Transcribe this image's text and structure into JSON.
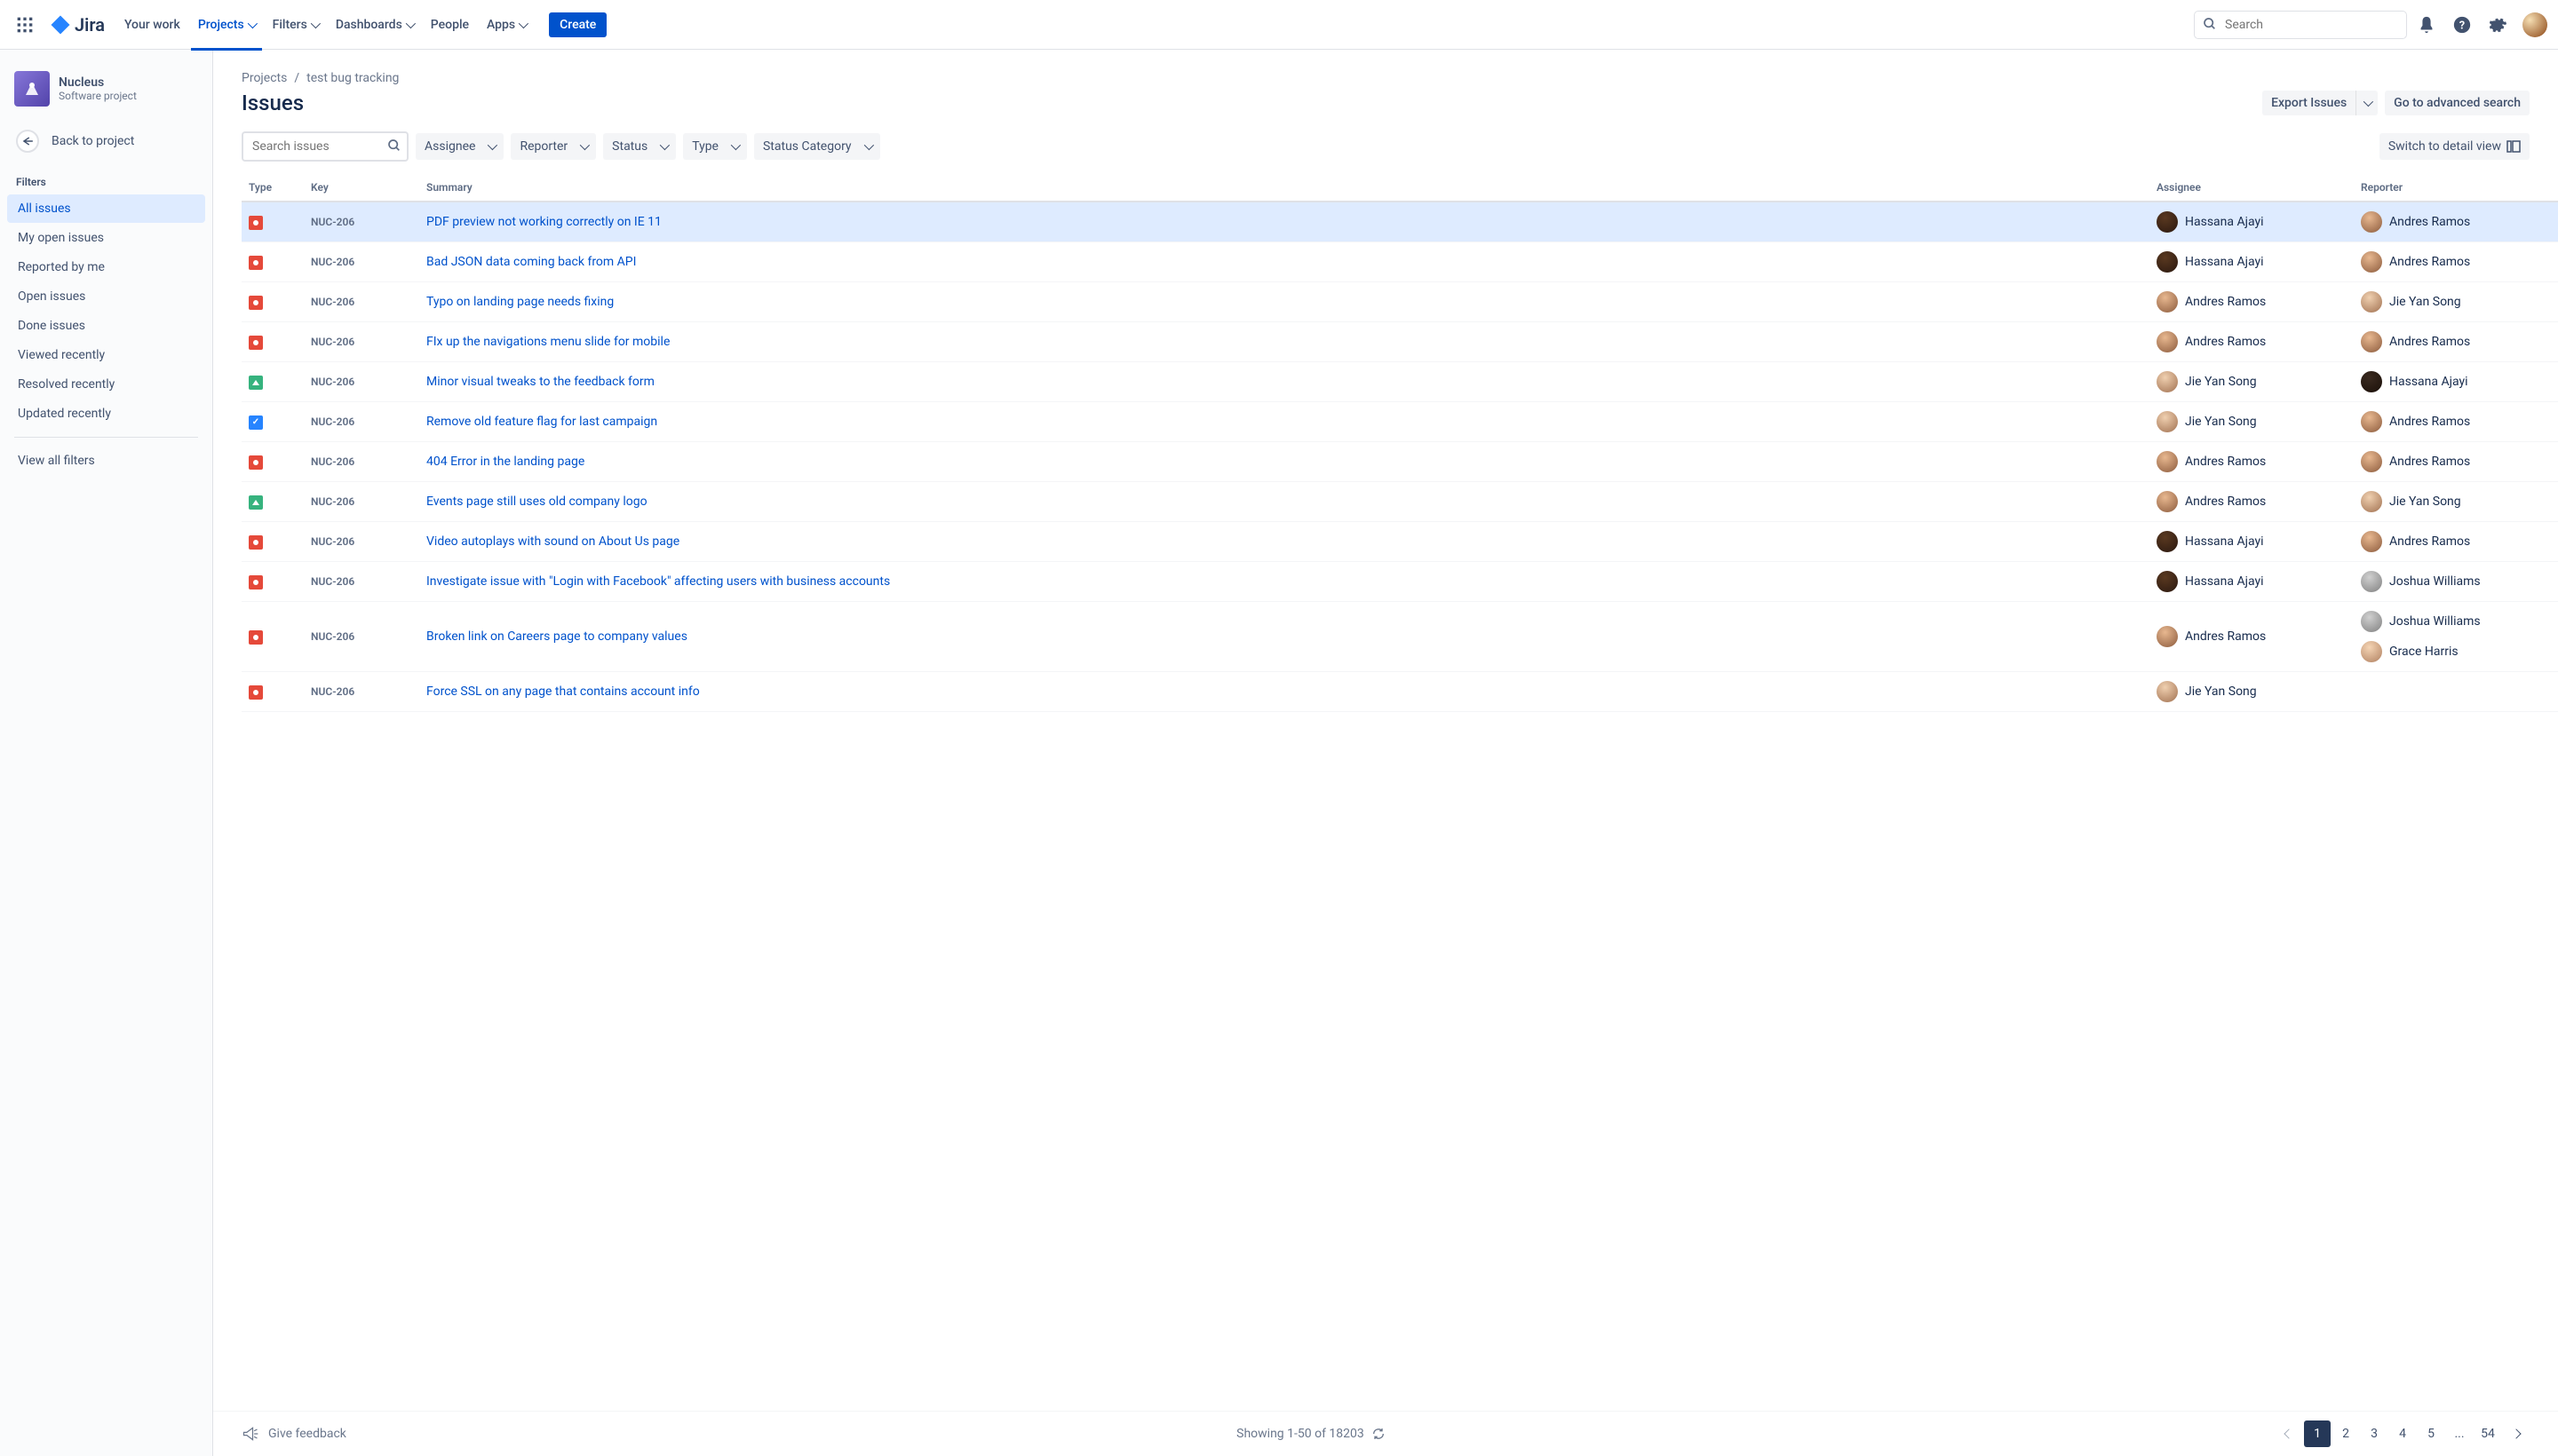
{
  "nav": {
    "logo": "Jira",
    "items": [
      {
        "label": "Your work",
        "active": false,
        "dropdown": false
      },
      {
        "label": "Projects",
        "active": true,
        "dropdown": true
      },
      {
        "label": "Filters",
        "active": false,
        "dropdown": true
      },
      {
        "label": "Dashboards",
        "active": false,
        "dropdown": true
      },
      {
        "label": "People",
        "active": false,
        "dropdown": false
      },
      {
        "label": "Apps",
        "active": false,
        "dropdown": true
      }
    ],
    "create": "Create",
    "search_placeholder": "Search"
  },
  "sidebar": {
    "project_name": "Nucleus",
    "project_type": "Software project",
    "back": "Back to project",
    "filters_heading": "Filters",
    "filters": [
      {
        "label": "All issues",
        "selected": true
      },
      {
        "label": "My open issues",
        "selected": false
      },
      {
        "label": "Reported by me",
        "selected": false
      },
      {
        "label": "Open issues",
        "selected": false
      },
      {
        "label": "Done issues",
        "selected": false
      },
      {
        "label": "Viewed recently",
        "selected": false
      },
      {
        "label": "Resolved recently",
        "selected": false
      },
      {
        "label": "Updated recently",
        "selected": false
      }
    ],
    "view_all": "View all filters"
  },
  "breadcrumb": [
    "Projects",
    "test bug tracking"
  ],
  "page_title": "Issues",
  "actions": {
    "export": "Export Issues",
    "advanced": "Go to advanced search"
  },
  "filters_bar": {
    "search_placeholder": "Search issues",
    "dropdowns": [
      "Assignee",
      "Reporter",
      "Status",
      "Type",
      "Status Category"
    ],
    "switch_view": "Switch to detail view"
  },
  "table": {
    "headers": [
      "Type",
      "Key",
      "Summary",
      "Assignee",
      "Reporter"
    ],
    "rows": [
      {
        "type": "bug",
        "key": "NUC-206",
        "summary": "PDF preview not working correctly on IE 11",
        "assignee": {
          "name": "Hassana Ajayi",
          "av": "av-1"
        },
        "reporter": {
          "name": "Andres Ramos",
          "av": "av-2"
        },
        "selected": true
      },
      {
        "type": "bug",
        "key": "NUC-206",
        "summary": "Bad JSON data coming back from API",
        "assignee": {
          "name": "Hassana Ajayi",
          "av": "av-1"
        },
        "reporter": {
          "name": "Andres Ramos",
          "av": "av-2"
        }
      },
      {
        "type": "bug",
        "key": "NUC-206",
        "summary": "Typo on landing page needs fixing",
        "assignee": {
          "name": "Andres Ramos",
          "av": "av-2"
        },
        "reporter": {
          "name": "Jie Yan Song",
          "av": "av-3"
        }
      },
      {
        "type": "bug",
        "key": "NUC-206",
        "summary": "FIx up the navigations menu slide for mobile",
        "assignee": {
          "name": "Andres Ramos",
          "av": "av-2"
        },
        "reporter": {
          "name": "Andres Ramos",
          "av": "av-2"
        }
      },
      {
        "type": "impr",
        "key": "NUC-206",
        "summary": "Minor visual tweaks to the feedback form",
        "assignee": {
          "name": "Jie Yan Song",
          "av": "av-3"
        },
        "reporter": {
          "name": "Hassana Ajayi",
          "av": "av-5"
        }
      },
      {
        "type": "task",
        "key": "NUC-206",
        "summary": "Remove old feature flag for last campaign",
        "assignee": {
          "name": "Jie Yan Song",
          "av": "av-3"
        },
        "reporter": {
          "name": "Andres Ramos",
          "av": "av-2"
        }
      },
      {
        "type": "bug",
        "key": "NUC-206",
        "summary": "404 Error in the landing page",
        "assignee": {
          "name": "Andres Ramos",
          "av": "av-2"
        },
        "reporter": {
          "name": "Andres Ramos",
          "av": "av-2"
        }
      },
      {
        "type": "impr",
        "key": "NUC-206",
        "summary": "Events page still uses old company logo",
        "assignee": {
          "name": "Andres Ramos",
          "av": "av-2"
        },
        "reporter": {
          "name": "Jie Yan Song",
          "av": "av-3"
        }
      },
      {
        "type": "bug",
        "key": "NUC-206",
        "summary": "Video autoplays with sound on About Us page",
        "assignee": {
          "name": "Hassana Ajayi",
          "av": "av-1"
        },
        "reporter": {
          "name": "Andres Ramos",
          "av": "av-2"
        }
      },
      {
        "type": "bug",
        "key": "NUC-206",
        "summary": "Investigate issue with \"Login with Facebook\" affecting users with business accounts",
        "assignee": {
          "name": "Hassana Ajayi",
          "av": "av-1"
        },
        "reporter": {
          "name": "Joshua Williams",
          "av": "av-4"
        }
      },
      {
        "type": "bug",
        "key": "NUC-206",
        "summary": "Broken link on Careers page to company values",
        "assignee": {
          "name": "Andres Ramos",
          "av": "av-2"
        },
        "reporter_override": [
          {
            "name": "Joshua Williams",
            "av": "av-4"
          },
          {
            "name": "Grace Harris",
            "av": "av-6"
          }
        ]
      },
      {
        "type": "bug",
        "key": "NUC-206",
        "summary": "Force SSL on any page that contains account info",
        "assignee": {
          "name": "Jie Yan Song",
          "av": "av-3"
        },
        "reporter": {
          "name": "",
          "av": ""
        }
      }
    ]
  },
  "footer": {
    "feedback": "Give feedback",
    "showing": "Showing 1-50 of 18203",
    "pages": [
      "1",
      "2",
      "3",
      "4",
      "5",
      "...",
      "54"
    ]
  }
}
